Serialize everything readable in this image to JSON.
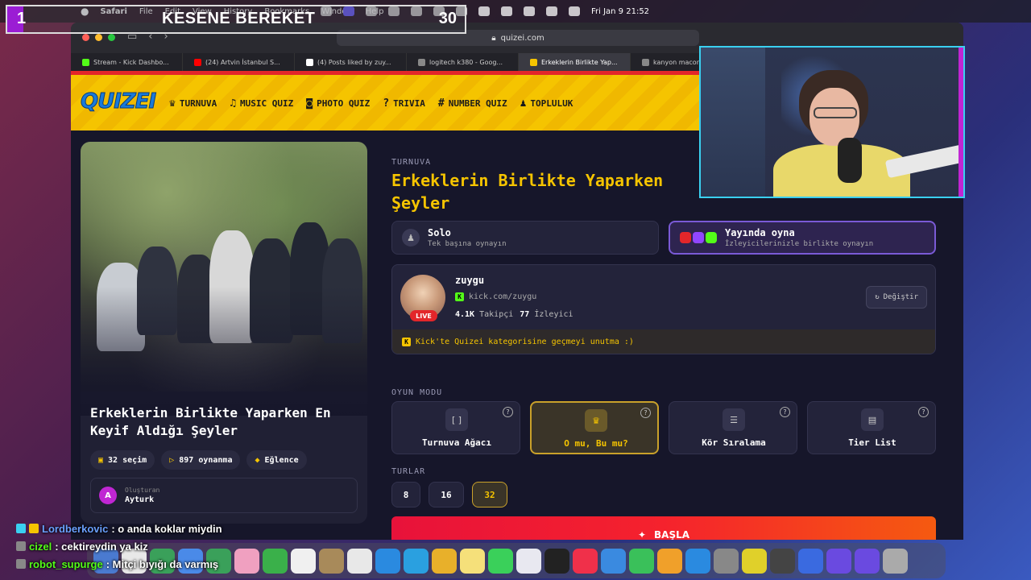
{
  "menubar": {
    "app": "Safari",
    "items": [
      "File",
      "Edit",
      "View",
      "History",
      "Bookmarks",
      "Window",
      "Help"
    ],
    "datetime": "Fri Jan 9  21:52"
  },
  "overlay": {
    "current": "1",
    "title": "KESENE BEREKET",
    "total": "30"
  },
  "browser": {
    "url": "quizei.com",
    "tabs": [
      {
        "label": "Stream - Kick Dashbo...",
        "color": "#53fc18"
      },
      {
        "label": "(24) Artvin İstanbul S...",
        "color": "#ff0000"
      },
      {
        "label": "(4) Posts liked by zuy...",
        "color": "#ffffff"
      },
      {
        "label": "logitech k380 - Goog...",
        "color": "#888888"
      },
      {
        "label": "Erkeklerin Birlikte Yap...",
        "color": "#f5c400"
      },
      {
        "label": "kanyon macon",
        "color": "#888888"
      }
    ]
  },
  "site": {
    "logo": "QUIZEI",
    "nav": [
      {
        "label": "TURNUVA",
        "icon": "trophy-icon",
        "glyph": "♛"
      },
      {
        "label": "MUSIC QUIZ",
        "icon": "music-icon",
        "glyph": "♫"
      },
      {
        "label": "PHOTO QUIZ",
        "icon": "camera-icon",
        "glyph": "◙"
      },
      {
        "label": "TRIVIA",
        "icon": "question-icon",
        "glyph": "?"
      },
      {
        "label": "NUMBER QUIZ",
        "icon": "hash-icon",
        "glyph": "#"
      },
      {
        "label": "TOPLULUK",
        "icon": "users-icon",
        "glyph": "♟"
      }
    ]
  },
  "quiz": {
    "card_title": "Erkeklerin Birlikte Yaparken En Keyif Aldığı Şeyler",
    "choices": "32 seçim",
    "plays": "897 oynanma",
    "category": "Eğlence",
    "creator_label": "Oluşturan",
    "creator": "Ayturk",
    "creator_initial": "A",
    "eyebrow": "TURNUVA",
    "title": "Erkeklerin Birlikte Yaparken Şeyler"
  },
  "modes": {
    "solo": {
      "title": "Solo",
      "subtitle": "Tek başına oynayın"
    },
    "stream": {
      "title": "Yayında oyna",
      "subtitle": "İzleyicilerinizle birlikte oynayın"
    }
  },
  "streamer": {
    "name": "zuygu",
    "link": "kick.com/zuygu",
    "live": "LIVE",
    "followers_count": "4.1K",
    "followers_label": "Takipçi",
    "viewers_count": "77",
    "viewers_label": "İzleyici",
    "change": "Değiştir",
    "notice": "Kick'te Quizei kategorisine geçmeyi unutma :)"
  },
  "game_mode": {
    "label": "OYUN MODU",
    "options": [
      {
        "label": "Turnuva Ağacı",
        "icon": "bracket-icon",
        "glyph": "[ ]"
      },
      {
        "label": "O mu, Bu mu?",
        "icon": "crown-icon",
        "glyph": "♛"
      },
      {
        "label": "Kör Sıralama",
        "icon": "list-icon",
        "glyph": "☰"
      },
      {
        "label": "Tier List",
        "icon": "table-icon",
        "glyph": "▤"
      }
    ],
    "selected": "O mu, Bu mu?"
  },
  "rounds": {
    "label": "TURLAR",
    "options": [
      "8",
      "16",
      "32"
    ],
    "selected": "32"
  },
  "start": "BAŞLA",
  "chat": [
    {
      "user": "Lordberkovic",
      "message": ": o anda koklar miydin"
    },
    {
      "user": "cizel",
      "message": ": cektireydin ya kiz"
    },
    {
      "user": "robot_supurge",
      "message": ": Mitçi bıyığı da varmış"
    }
  ],
  "colors": {
    "accent": "#f5c400",
    "kick_green": "#53fc18",
    "start_red": "#f5222d"
  }
}
